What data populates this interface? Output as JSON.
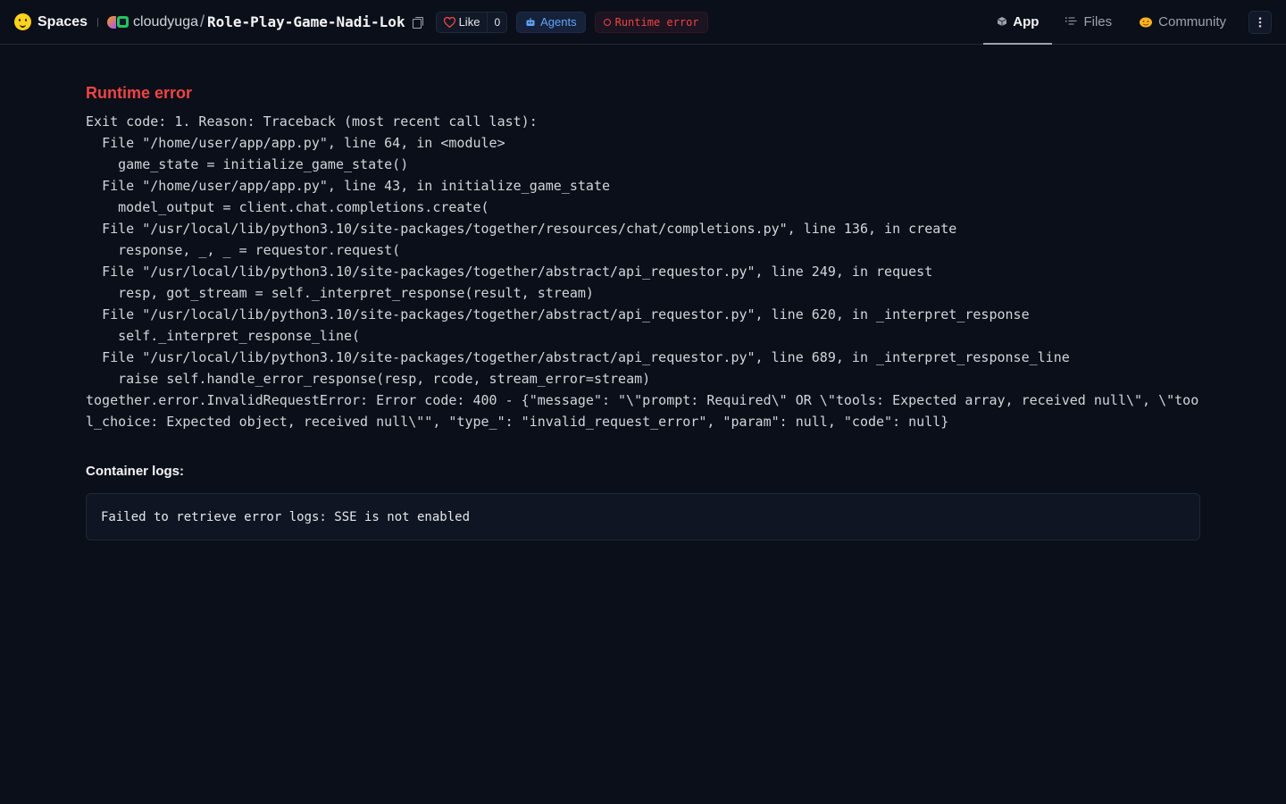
{
  "header": {
    "brand": "Spaces",
    "owner": "cloudyuga",
    "repo": "Role-Play-Game-Nadi-Lok",
    "like_label": "Like",
    "like_count": "0",
    "agents_label": "Agents",
    "status_label": "Runtime error",
    "tabs": [
      {
        "label": "App",
        "icon": "cube-icon"
      },
      {
        "label": "Files",
        "icon": "files-icon"
      },
      {
        "label": "Community",
        "icon": "community-icon"
      }
    ],
    "colors": {
      "status": "#ef4444",
      "agents": "#60a5fa",
      "background": "#0b0f19"
    }
  },
  "error": {
    "title": "Runtime error",
    "traceback": "Exit code: 1. Reason: Traceback (most recent call last):\n  File \"/home/user/app/app.py\", line 64, in <module>\n    game_state = initialize_game_state()\n  File \"/home/user/app/app.py\", line 43, in initialize_game_state\n    model_output = client.chat.completions.create(\n  File \"/usr/local/lib/python3.10/site-packages/together/resources/chat/completions.py\", line 136, in create\n    response, _, _ = requestor.request(\n  File \"/usr/local/lib/python3.10/site-packages/together/abstract/api_requestor.py\", line 249, in request\n    resp, got_stream = self._interpret_response(result, stream)\n  File \"/usr/local/lib/python3.10/site-packages/together/abstract/api_requestor.py\", line 620, in _interpret_response\n    self._interpret_response_line(\n  File \"/usr/local/lib/python3.10/site-packages/together/abstract/api_requestor.py\", line 689, in _interpret_response_line\n    raise self.handle_error_response(resp, rcode, stream_error=stream)\ntogether.error.InvalidRequestError: Error code: 400 - {\"message\": \"\\\"prompt: Required\\\" OR \\\"tools: Expected array, received null\\\", \\\"tool_choice: Expected object, received null\\\"\", \"type_\": \"invalid_request_error\", \"param\": null, \"code\": null}"
  },
  "logs": {
    "heading": "Container logs:",
    "message": "Failed to retrieve error logs: SSE is not enabled"
  }
}
